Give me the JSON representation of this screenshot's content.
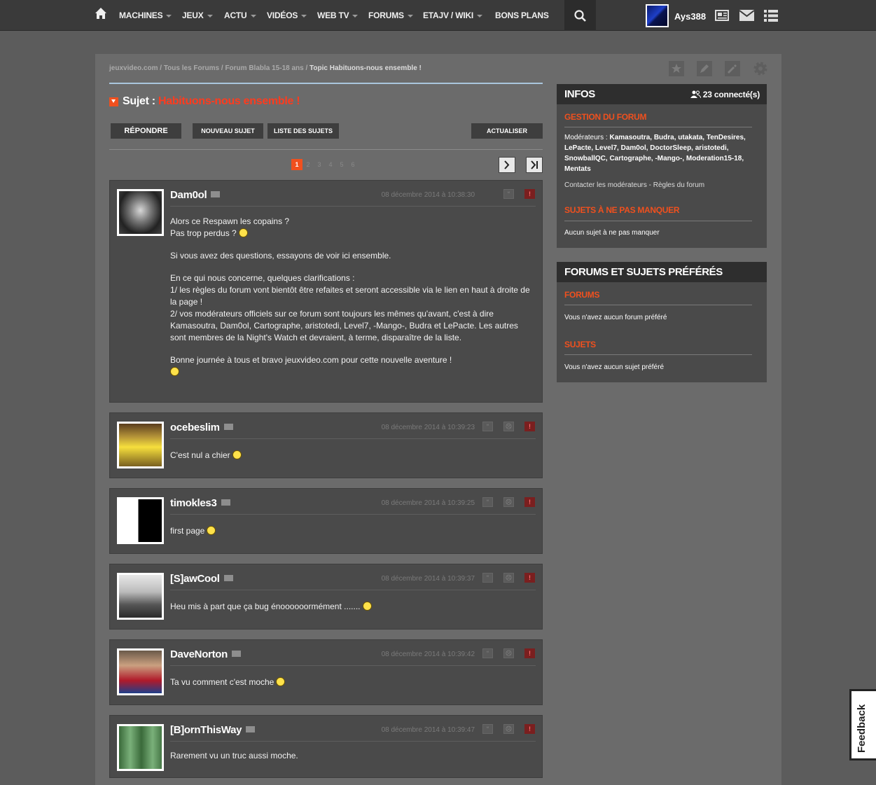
{
  "nav": {
    "items": [
      {
        "label": "MACHINES",
        "caret": true
      },
      {
        "label": "JEUX",
        "caret": true
      },
      {
        "label": "ACTU",
        "caret": true
      },
      {
        "label": "VIDÉOS",
        "caret": true
      },
      {
        "label": "WEB TV",
        "caret": true
      },
      {
        "label": "FORUMS",
        "caret": true
      },
      {
        "label": "ETAJV / WIKI",
        "caret": true
      },
      {
        "label": "BONS PLANS",
        "caret": false
      }
    ],
    "username": "Ays388"
  },
  "breadcrumb": {
    "items": [
      "jeuxvideo.com",
      "Tous les Forums",
      "Forum Blabla 15-18 ans"
    ],
    "current": "Topic Habituons-nous ensemble !",
    "separator": " / "
  },
  "subject": {
    "prefix": "Sujet :",
    "title": "Habituons-nous ensemble !"
  },
  "buttons": {
    "reply": "RÉPONDRE",
    "new_subject": "NOUVEAU SUJET",
    "subject_list": "LISTE DES SUJETS",
    "refresh": "ACTUALISER"
  },
  "pagination": {
    "pages": [
      "1",
      "2",
      "3",
      "4",
      "5",
      "6"
    ],
    "current": "1"
  },
  "posts": [
    {
      "author": "Dam0ol",
      "date": "08 décembre 2014 à 10:38:30",
      "paragraphs": [
        "Alors ce Respawn les copains ?\nPas trop perdus ?",
        "Si vous avez des questions, essayons de voir ici ensemble.",
        "En ce qui nous concerne, quelques clarifications :\n1/ les règles du forum vont bientôt être refaites et seront accessible via le lien en haut à droite de la page !\n2/ vos modérateurs officiels sur ce forum sont toujours les mêmes qu'avant, c'est à dire Kamasoutra, Dam0ol, Cartographe, aristotedi, Level7, -Mango-, Budra et LePacte. Les autres sont membres de la Night's Watch et devraient, à terme, disparaître de la liste.",
        "Bonne journée à tous et bravo jeuxvideo.com pour cette nouvelle aventure !"
      ]
    },
    {
      "author": "ocebeslim",
      "date": "08 décembre 2014 à 10:39:23",
      "paragraphs": [
        "C'est nul a chier"
      ]
    },
    {
      "author": "timokles3",
      "date": "08 décembre 2014 à 10:39:25",
      "paragraphs": [
        "first page"
      ]
    },
    {
      "author": "[S]awCool",
      "date": "08 décembre 2014 à 10:39:37",
      "paragraphs": [
        "Heu mis à part que ça bug énoooooormément ......."
      ]
    },
    {
      "author": "DaveNorton",
      "date": "08 décembre 2014 à 10:39:42",
      "paragraphs": [
        "Ta vu comment c'est moche"
      ]
    },
    {
      "author": "[B]ornThisWay",
      "date": "08 décembre 2014 à 10:39:47",
      "paragraphs": [
        "Rarement vu un truc aussi moche."
      ]
    }
  ],
  "sidebar": {
    "infos": {
      "title": "INFOS",
      "connected": "23 connecté(s)",
      "forum_management": "GESTION DU FORUM",
      "moderators_label": "Modérateurs :",
      "moderators": "Kamasoutra, Budra, utakata, TenDesires, LePacte, Level7, Dam0ol, DoctorSleep, aristotedi, SnowballQC, Cartographe, -Mango-, Moderation15-18, Mentats",
      "contact": "Contacter les modérateurs",
      "rules": "Règles du forum",
      "must_see": "SUJETS À NE PAS MANQUER",
      "must_see_empty": "Aucun sujet à ne pas manquer"
    },
    "favorites": {
      "title": "FORUMS ET SUJETS PRÉFÉRÉS",
      "forums": "FORUMS",
      "forums_empty": "Vous n'avez aucun forum préféré",
      "subjects": "SUJETS",
      "subjects_empty": "Vous n'avez aucun sujet préféré"
    }
  },
  "feedback": "Feedback"
}
